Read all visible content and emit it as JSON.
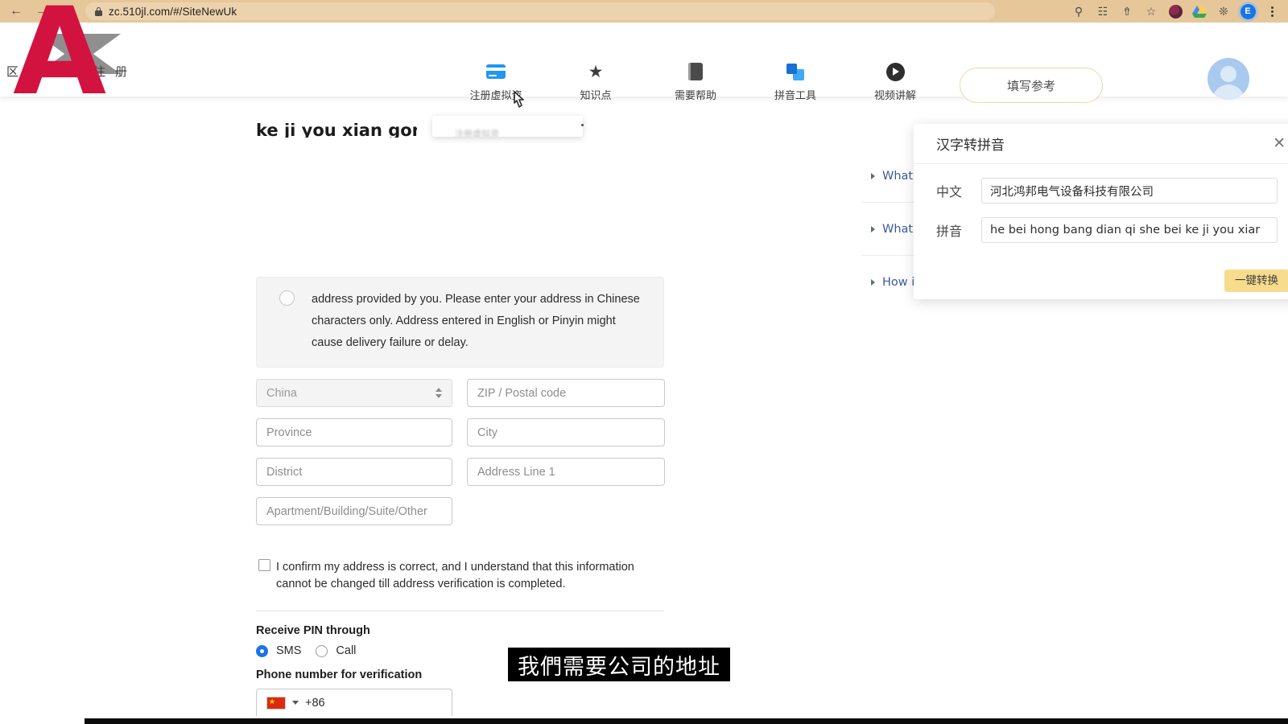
{
  "browser": {
    "back_icon": "back-arrow-icon",
    "forward_icon": "forward-arrow-icon",
    "reload_icon": "reload-icon",
    "url": "zc.510jl.com/#/SiteNewUk",
    "lock_icon": "lock-icon",
    "toolbar_icons": [
      "key-icon",
      "translate-icon",
      "share-icon",
      "bookmark-star-icon",
      "extension-dot-icon",
      "google-drive-icon",
      "puzzle-extensions-icon"
    ],
    "profile_initial": "E",
    "menu_icon": "kebab-menu-icon"
  },
  "site": {
    "brand_text": "区域中心注册",
    "watermark": "A",
    "nav": [
      {
        "label": "注册虚拟资",
        "icon": "credit-card-icon"
      },
      {
        "label": "知识点",
        "icon": "star-icon"
      },
      {
        "label": "需要帮助",
        "icon": "book-icon"
      },
      {
        "label": "拼音工具",
        "icon": "pinyin-tool-icon"
      },
      {
        "label": "视频讲解",
        "icon": "play-circle-icon"
      }
    ],
    "reference_button": "填写参考",
    "avatar": "user-avatar",
    "dropdown_blur_text": "注册虚拟资",
    "clipped_heading": "ke ji you xian gong si"
  },
  "faq": [
    {
      "label": "What if"
    },
    {
      "label": "What s"
    },
    {
      "label": "How is"
    }
  ],
  "pinyin_panel": {
    "title": "汉字转拼音",
    "close_icon": "close-icon",
    "chinese_label": "中文",
    "chinese_value": "河北鸿邦电气设备科技有限公司",
    "pinyin_label": "拼音",
    "pinyin_value": "he bei hong bang dian qi she bei ke ji you xiar",
    "convert_button": "一键转换",
    "accent_color": "#f7dc8e"
  },
  "form": {
    "notice": "address provided by you. Please enter your address in Chinese characters only. Address entered in English or Pinyin might cause delivery failure or delay.",
    "country_value": "China",
    "zip_placeholder": "ZIP / Postal code",
    "province_placeholder": "Province",
    "city_placeholder": "City",
    "district_placeholder": "District",
    "address_line1_placeholder": "Address Line 1",
    "apartment_placeholder": "Apartment/Building/Suite/Other",
    "confirm_text": "I confirm my address is correct, and I understand that this information cannot be changed till address verification is completed.",
    "pin_label": "Receive PIN through",
    "pin_options": [
      {
        "label": "SMS",
        "selected": true
      },
      {
        "label": "Call",
        "selected": false
      }
    ],
    "phone_label": "Phone number for verification",
    "dial_code": "+86",
    "flag": "china-flag-icon"
  },
  "subtitle": "我們需要公司的地址"
}
